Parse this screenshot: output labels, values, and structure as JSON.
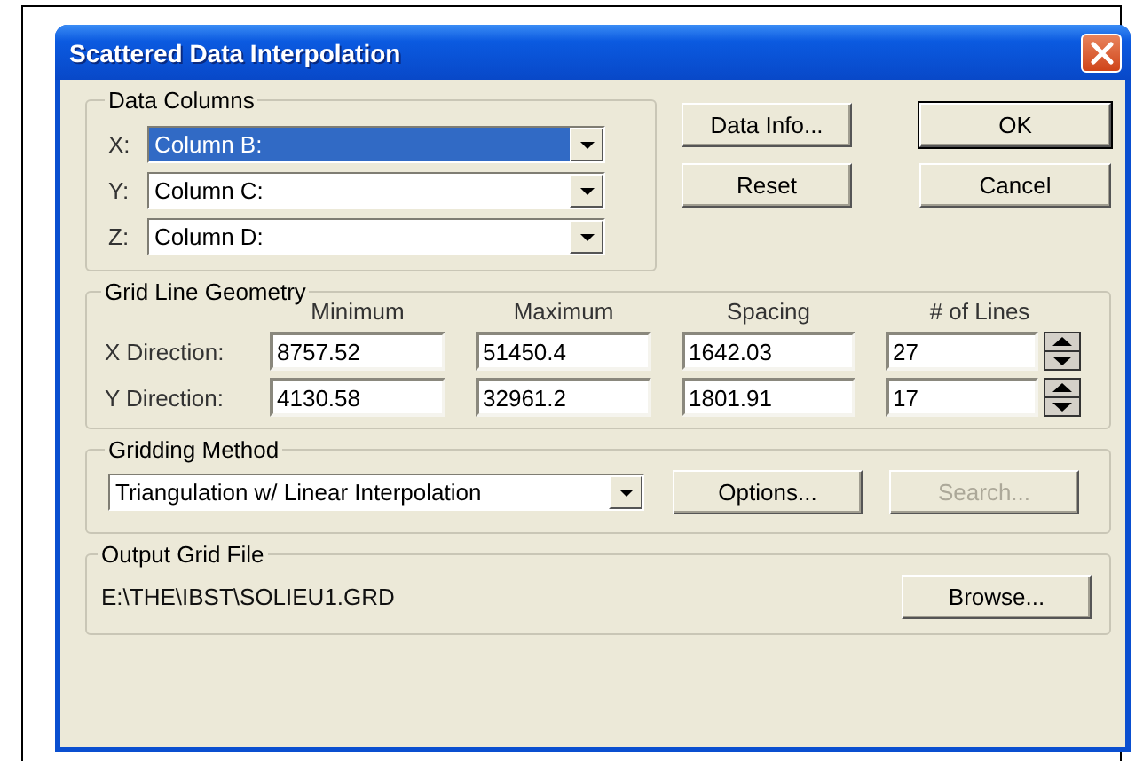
{
  "window": {
    "title": "Scattered Data Interpolation"
  },
  "data_columns": {
    "title": "Data Columns",
    "fields": [
      {
        "label": "X:",
        "value": "Column B:",
        "selected": true
      },
      {
        "label": "Y:",
        "value": "Column C:",
        "selected": false
      },
      {
        "label": "Z:",
        "value": "Column D:",
        "selected": false
      }
    ]
  },
  "buttons": [
    {
      "label": "Data Info...",
      "default": false
    },
    {
      "label": "OK",
      "default": true
    },
    {
      "label": "Reset",
      "default": false
    },
    {
      "label": "Cancel",
      "default": false
    }
  ],
  "grid_geometry": {
    "title": "Grid Line Geometry",
    "columns": [
      "Minimum",
      "Maximum",
      "Spacing",
      "# of Lines"
    ],
    "rows": [
      {
        "label": "X Direction:",
        "values": [
          "8757.52",
          "51450.4",
          "1642.03",
          "27"
        ]
      },
      {
        "label": "Y Direction:",
        "values": [
          "4130.58",
          "32961.2",
          "1801.91",
          "17"
        ]
      }
    ]
  },
  "gridding_method": {
    "title": "Gridding Method",
    "value": "Triangulation w/ Linear Interpolation",
    "buttons": [
      {
        "label": "Options...",
        "disabled": false
      },
      {
        "label": "Search...",
        "disabled": true
      }
    ]
  },
  "output_grid_file": {
    "title": "Output Grid File",
    "path": "E:\\THE\\IBST\\SOLIEU1.GRD",
    "button": "Browse..."
  }
}
